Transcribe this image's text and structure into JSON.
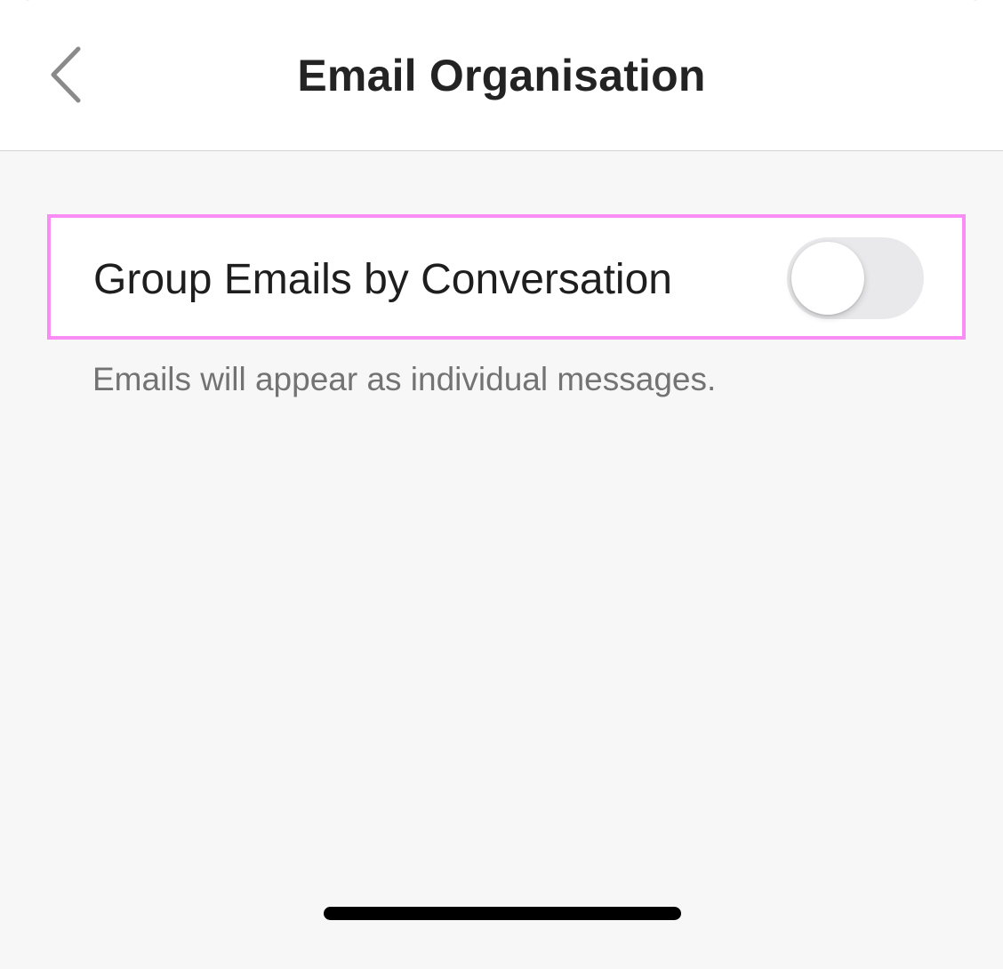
{
  "header": {
    "title": "Email Organisation",
    "back_icon": "chevron-left-icon"
  },
  "setting": {
    "label": "Group Emails by Conversation",
    "toggle_on": false,
    "helper_text": "Emails will appear as individual messages."
  },
  "colors": {
    "highlight_border": "#f98cf5",
    "toggle_off_track": "#e9e9eb",
    "title_text": "#232323",
    "helper_text": "#737373"
  }
}
